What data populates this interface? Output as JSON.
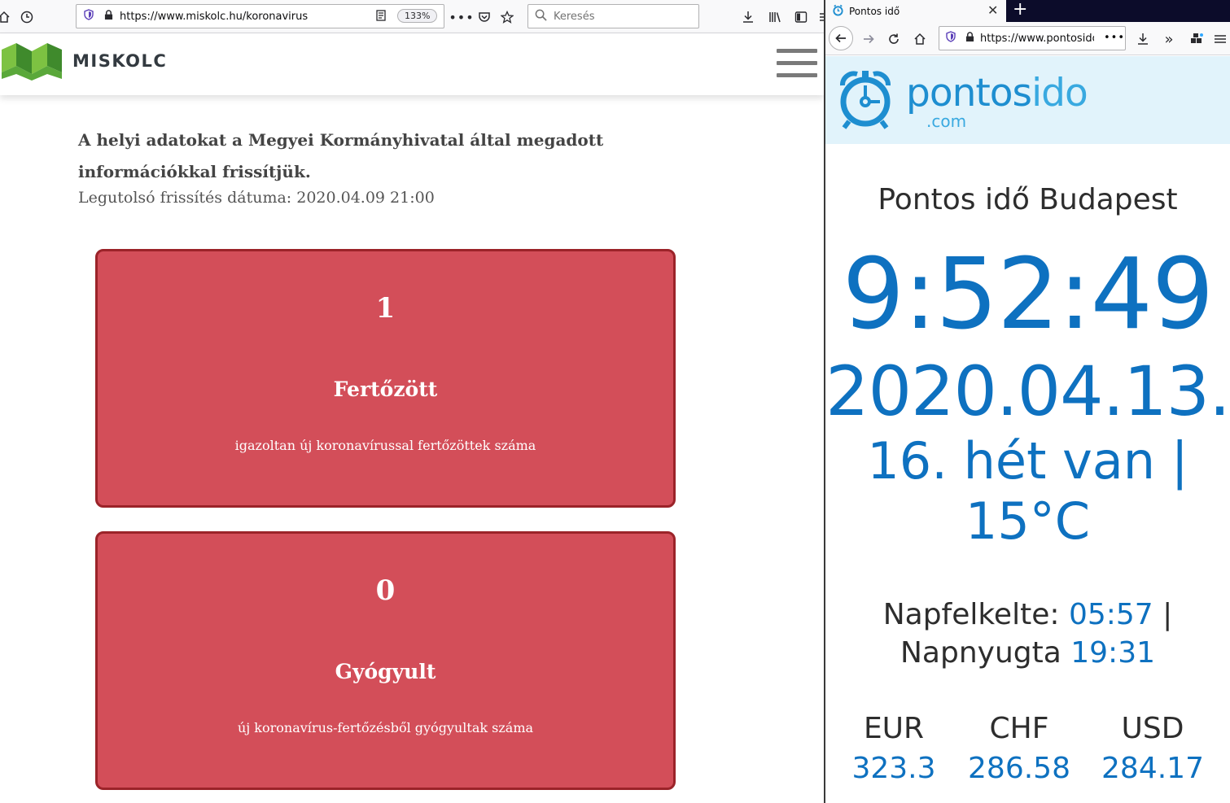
{
  "left_browser": {
    "url": "https://www.miskolc.hu/koronavirus",
    "zoom": "133%",
    "search_placeholder": "Keresés"
  },
  "miskolc": {
    "logo_text": "MISKOLC",
    "intro": "A helyi adatokat a Megyei Kormányhivatal által megadott információkkal frissítjük.",
    "updated": "Legutolsó frissítés dátuma: 2020.04.09 21:00",
    "cards": [
      {
        "value": "1",
        "title": "Fertőzött",
        "desc": "igazoltan új koronavírussal fertőzöttek száma"
      },
      {
        "value": "0",
        "title": "Gyógyult",
        "desc": "új koronavírus-fertőzésből gyógyultak száma"
      }
    ]
  },
  "right_browser": {
    "tab_title": "Pontos idő",
    "url": "https://www.pontosido"
  },
  "pontosido": {
    "brand_main": "pontos",
    "brand_accent": "ido",
    "brand_domain": ".com",
    "city_title": "Pontos idő Budapest",
    "time": "9:52:49",
    "date": "2020.04.13.",
    "week_line1": "16. hét van |",
    "week_line2": "15°C",
    "sunrise_label": "Napfelkelte:",
    "sunrise": "05:57",
    "sunrise_sep": "|",
    "sunset_label": "Napnyugta",
    "sunset": "19:31",
    "currencies": [
      {
        "code": "EUR",
        "rate": "323.3"
      },
      {
        "code": "CHF",
        "rate": "286.58"
      },
      {
        "code": "USD",
        "rate": "284.17"
      }
    ]
  },
  "colors": {
    "card_fill": "#d34e59",
    "card_border": "#9b2329",
    "accent_blue": "#0e71c0",
    "logo_green_dark": "#3f8a2c",
    "logo_green_light": "#7dc242"
  }
}
